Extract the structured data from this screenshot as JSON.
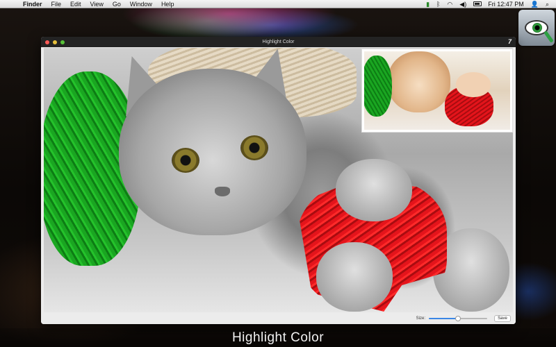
{
  "menubar": {
    "app_name": "Finder",
    "items": [
      "File",
      "Edit",
      "View",
      "Go",
      "Window",
      "Help"
    ],
    "clock": "Fri 12:47 PM",
    "status_icons": [
      "evernote-icon",
      "bluetooth-icon",
      "wifi-icon",
      "volume-icon",
      "battery-icon",
      "user-icon",
      "spotlight-icon"
    ]
  },
  "window": {
    "title": "Highlight Color",
    "badge": "7"
  },
  "toolbar": {
    "size_label": "Size:",
    "size_value": 0.5,
    "save_label": "Save"
  },
  "caption": "Highlight Color",
  "colors": {
    "highlight_green": "#1aa621",
    "highlight_red": "#e4141b",
    "slider_accent": "#3b86e5"
  }
}
